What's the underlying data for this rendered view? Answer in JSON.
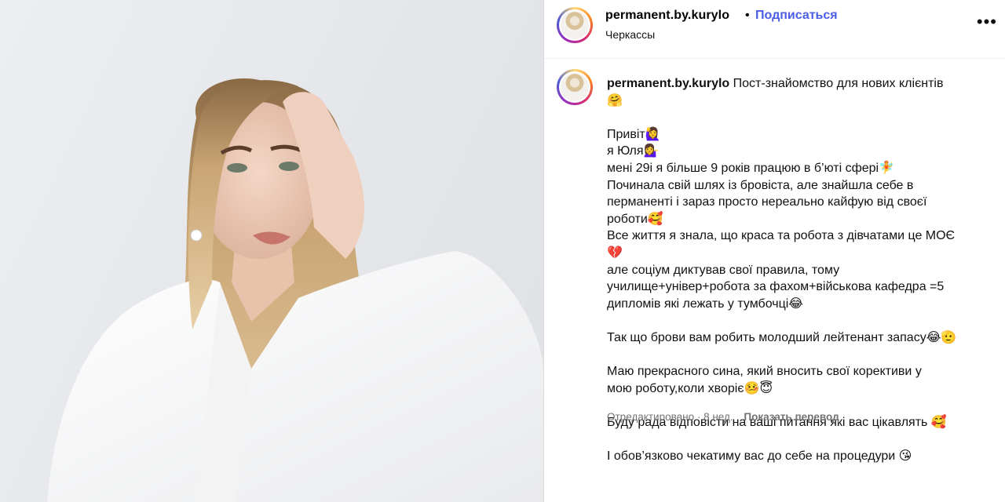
{
  "post": {
    "username": "permanent.by.kurylo",
    "separator": "•",
    "follow_label": "Подписаться",
    "location": "Черкассы",
    "more_label": "•••"
  },
  "caption": {
    "username": "permanent.by.kurylo",
    "lines": [
      "Пост-знайомство для нових клієнтів",
      "🤗",
      "",
      "Привіт🙋‍♀️",
      "я Юля💁‍♀️",
      "мені 29і я більше 9 років працюю в б’юті сфері🧚",
      "Починала свій шлях із бровіста, але знайшла себе в",
      "перманенті і зараз просто нереально кайфую від своєї",
      "роботи🥰",
      "Все життя я знала, що краса та робота з дівчатами це МОЄ",
      "💔",
      "але соціум диктував свої правила, тому",
      "училище+універ+робота за фахом+військова кафедра =5",
      "дипломів які лежать у тумбочці😂",
      "",
      "Так що брови вам робить молодший лейтенант запасу😂🫡",
      "",
      "Маю прекрасного сина, який вносить свої корективи у",
      "мою роботу,коли хворіє🤒😇",
      "",
      "Буду рада відповісти на ваші питання які вас цікавлять 🥰",
      "",
      "І обов’язково чекатиму вас до себе на процедури 😘"
    ]
  },
  "meta": {
    "edited": "Отредактировано · 8 нед.",
    "translate_label": "Показать перевод"
  }
}
